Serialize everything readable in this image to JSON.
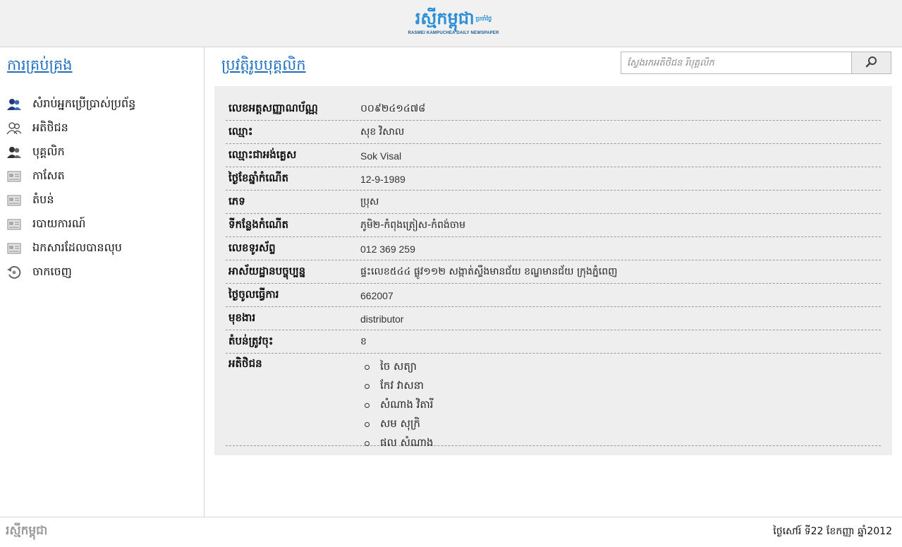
{
  "header": {
    "logo_text": "រស្មីកម្ពុជា",
    "logo_tag": "ប្រចាំថ្ងៃ",
    "logo_subtitle": "RASMEI KAMPUCHEA DAILY NEWSPAPER"
  },
  "sidebar": {
    "title": "ការគ្រប់គ្រង",
    "items": [
      {
        "label": "សំរាប់អ្នកប្រើប្រាស់ប្រព័ន្ធ",
        "icon": "users-admin-icon"
      },
      {
        "label": "អតិថិជន",
        "icon": "customers-icon"
      },
      {
        "label": "បុគ្គលិក",
        "icon": "staff-icon"
      },
      {
        "label": "កាសែត",
        "icon": "newspaper-icon"
      },
      {
        "label": "តំបន់",
        "icon": "region-icon"
      },
      {
        "label": "របាយការណ៍",
        "icon": "report-icon"
      },
      {
        "label": "ឯកសារដែលបានលុប",
        "icon": "deleted-docs-icon"
      },
      {
        "label": "ចាកចេញ",
        "icon": "logout-icon"
      }
    ]
  },
  "main": {
    "title": "ប្រវត្តិរូបបុគ្គលិក",
    "search": {
      "placeholder": "ស្វែងរកអតិថិជន រឺបុគ្គលិក",
      "value": ""
    }
  },
  "profile": {
    "fields": [
      {
        "label": "លេខអត្តសញ្ញាណប័ណ្ណ",
        "value": "០០៩២៤១៤៧៨"
      },
      {
        "label": "ឈ្មោះ",
        "value": "សុខ វិសាល"
      },
      {
        "label": "ឈ្មោះជាអង់គ្លេស",
        "value": "Sok Visal"
      },
      {
        "label": "ថ្ងៃខែឆ្នាំកំណើត",
        "value": "12-9-1989"
      },
      {
        "label": "ភេទ",
        "value": "ប្រុស"
      },
      {
        "label": "ទីកន្លែងកំណើត",
        "value": "ភូមិ២-កំពុងត្រៀស-កំពង់ចាម"
      },
      {
        "label": "លេខទូរស័ព្ទ",
        "value": "012 369 259"
      },
      {
        "label": "អាស័យដ្ឋានបច្ចុប្បន្ន",
        "value": "ផ្ទះលេខ៥៤៤ ផ្លូវ១១២ សង្កាត់ស្ទឹងមានជ័យ ខណ្ឌមានជ័យ ក្រុងភ្នំពេញ"
      },
      {
        "label": "ថ្ងៃចូលធ្វើការ",
        "value": "662007"
      },
      {
        "label": "មុខងារ",
        "value": "distributor"
      },
      {
        "label": "តំបន់ត្រូវចុះ",
        "value": "ខ"
      }
    ],
    "customers_label": "អតិថិជន",
    "customers": [
      "ចៃ សត្យា",
      "កែវ វាសនា",
      "សំណាង វិតារី",
      "សម សុក្រិ",
      "ផល សំណាង"
    ]
  },
  "footer": {
    "logo_text": "រស្មីកម្ពុជា",
    "date": "ថ្ងៃសៅរ៍ ទី22 ខែកញ្ញា ឆ្នាំ2012"
  },
  "colors": {
    "accent": "#1e6fc0",
    "logo_blue": "#2a8fd6",
    "header_bg": "#f1f1f1",
    "panel_bg": "#eeeeee"
  }
}
